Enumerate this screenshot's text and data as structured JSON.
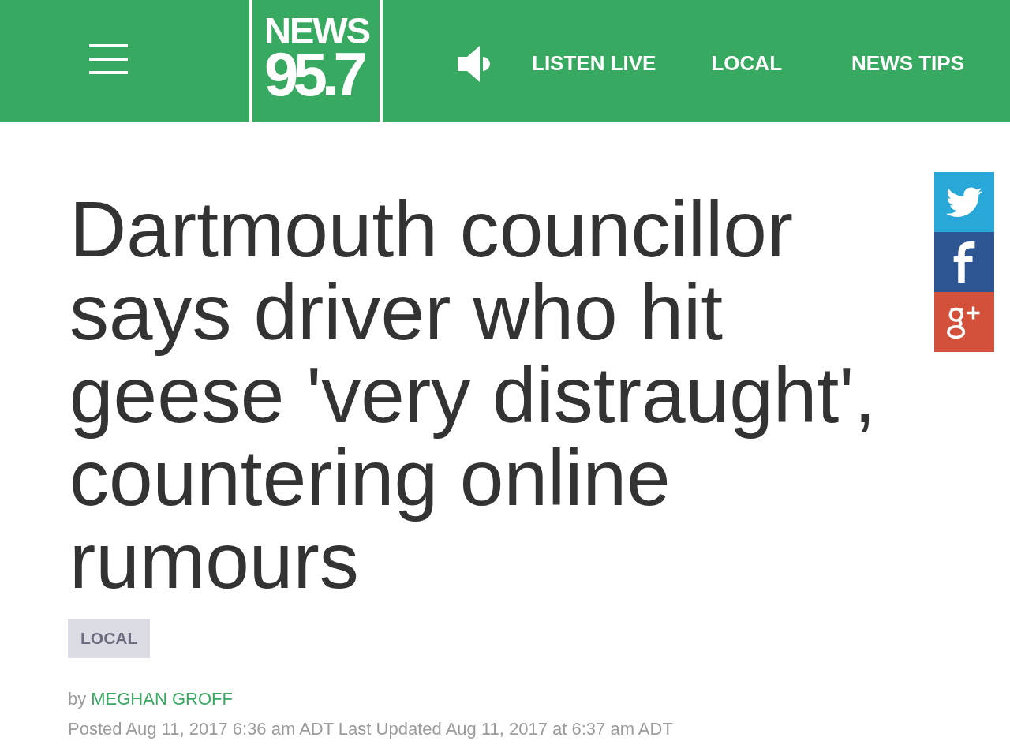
{
  "header": {
    "logo": {
      "line_1": "NEWS",
      "line_2": "95.7"
    },
    "nav": [
      {
        "label": "LISTEN LIVE"
      },
      {
        "label": "LOCAL"
      },
      {
        "label": "NEWS TIPS"
      }
    ]
  },
  "share_buttons": [
    {
      "kind": "bird",
      "color": "#28a8d9"
    },
    {
      "kind": "f",
      "color": "#2d5592"
    },
    {
      "kind": "gplus",
      "color": "#d3503b"
    }
  ],
  "article": {
    "headline": "Dartmouth councillor says driver who hit geese 'very distraught', countering online rumours",
    "category": "LOCAL",
    "byline": {
      "prefix": "by",
      "author": "MEGHAN GROFF"
    },
    "dateline": "Posted Aug 11, 2017 6:36 am ADT Last Updated Aug 11, 2017 at 6:37 am ADT"
  }
}
